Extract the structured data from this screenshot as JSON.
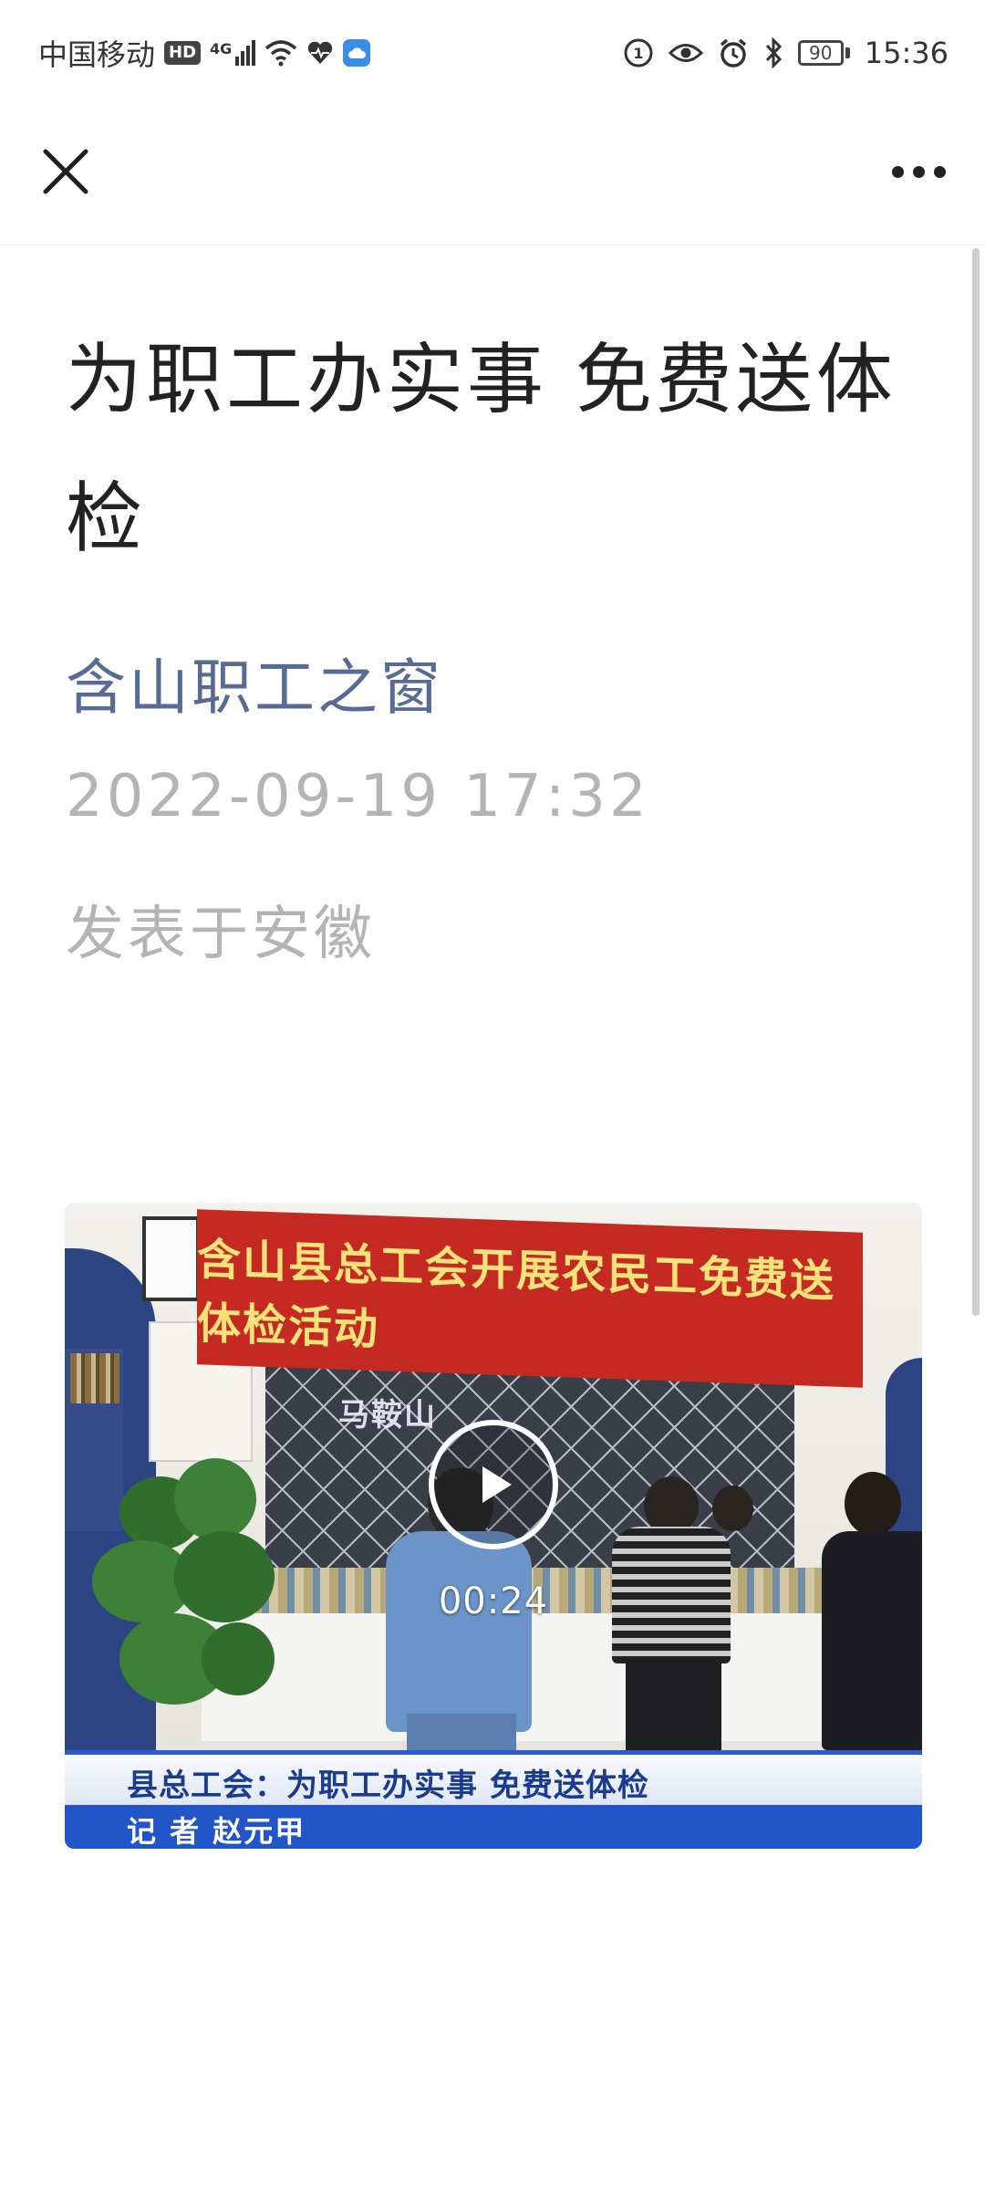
{
  "status_bar": {
    "carrier": "中国移动",
    "hd_badge": "HD",
    "network": "4G",
    "battery_level": "90",
    "time": "15:36"
  },
  "nav": {
    "close_icon": "close-icon",
    "more_icon": "more-icon"
  },
  "article": {
    "title": "为职工办实事 免费送体检",
    "account_name": "含山职工之窗",
    "publish_time": "2022-09-19 17:32",
    "location": "发表于安徽"
  },
  "video": {
    "banner_text": "含山县总工会开展农民工免费送体检活动",
    "sign_text": "马鞍山",
    "duration": "00:24",
    "caption_line1": "县总工会：为职工办实事 免费送体检",
    "caption_line2": "记 者 赵元甲",
    "play_icon": "play-icon"
  },
  "colors": {
    "account_link": "#576b95",
    "meta_gray": "#b4b4b4",
    "title": "#222222"
  }
}
